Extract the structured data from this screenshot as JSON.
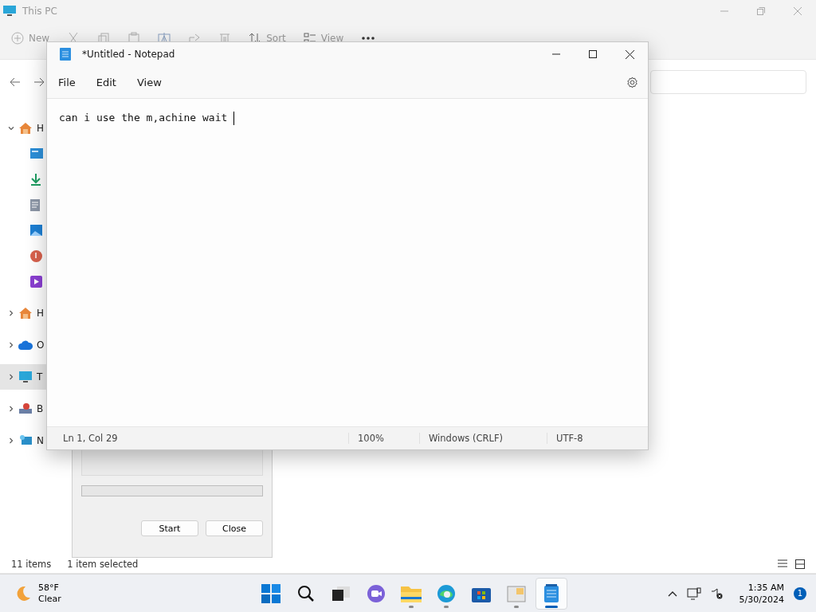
{
  "explorer": {
    "title": "This PC",
    "toolbar": [
      {
        "kind": "new",
        "label": "New"
      },
      {
        "kind": "cut"
      },
      {
        "kind": "copy"
      },
      {
        "kind": "paste"
      },
      {
        "kind": "rename"
      },
      {
        "kind": "share"
      },
      {
        "kind": "delete"
      },
      {
        "kind": "sort",
        "label": "Sort"
      },
      {
        "kind": "view",
        "label": "View"
      },
      {
        "kind": "more"
      }
    ],
    "sidebar": {
      "items": [
        {
          "kind": "home",
          "label": "H",
          "expanded": true,
          "selected": false,
          "children": [
            {
              "kind": "desktop",
              "selected": false
            },
            {
              "kind": "downloads",
              "selected": false
            },
            {
              "kind": "documents",
              "selected": false
            },
            {
              "kind": "pictures",
              "selected": false
            },
            {
              "kind": "music",
              "selected": false
            },
            {
              "kind": "videos",
              "selected": false
            }
          ]
        },
        {
          "kind": "home",
          "label": "H",
          "expanded": false,
          "selected": false
        },
        {
          "kind": "cloud",
          "label": "O",
          "expanded": false,
          "selected": false
        },
        {
          "kind": "pc",
          "label": "T",
          "expanded": false,
          "selected": true
        },
        {
          "kind": "drive",
          "label": "B",
          "expanded": false,
          "selected": false
        },
        {
          "kind": "network",
          "label": "N",
          "expanded": false,
          "selected": false
        }
      ]
    },
    "status_bar": {
      "count": "11 items",
      "selection": "1 item selected"
    }
  },
  "dialog": {
    "progress": {
      "level": 0
    },
    "buttons": [
      "Start",
      "Close"
    ]
  },
  "notepad": {
    "title": "*Untitled - Notepad",
    "menu": [
      "File",
      "Edit",
      "View"
    ],
    "text": "can i use the m,achine wait ",
    "status_bar": {
      "position": "Ln 1, Col 29",
      "zoom": "100%",
      "line_ending": "Windows (CRLF)",
      "encoding": "UTF-8"
    }
  },
  "taskbar": {
    "weather": {
      "temperature": "58°F",
      "condition": "Clear"
    },
    "apps": [
      {
        "kind": "start",
        "running": false,
        "selected": false
      },
      {
        "kind": "search",
        "running": false,
        "selected": false
      },
      {
        "kind": "taskview",
        "running": false,
        "selected": false
      },
      {
        "kind": "chat",
        "running": false,
        "selected": false
      },
      {
        "kind": "explorer",
        "running": true,
        "selected": false
      },
      {
        "kind": "browser",
        "running": true,
        "selected": false
      },
      {
        "kind": "store",
        "running": false,
        "selected": false
      },
      {
        "kind": "app",
        "running": true,
        "selected": false
      },
      {
        "kind": "notepad",
        "running": true,
        "selected": true
      }
    ],
    "clock": {
      "time": "1:35 AM",
      "date": "5/30/2024"
    },
    "notifications": "1"
  }
}
